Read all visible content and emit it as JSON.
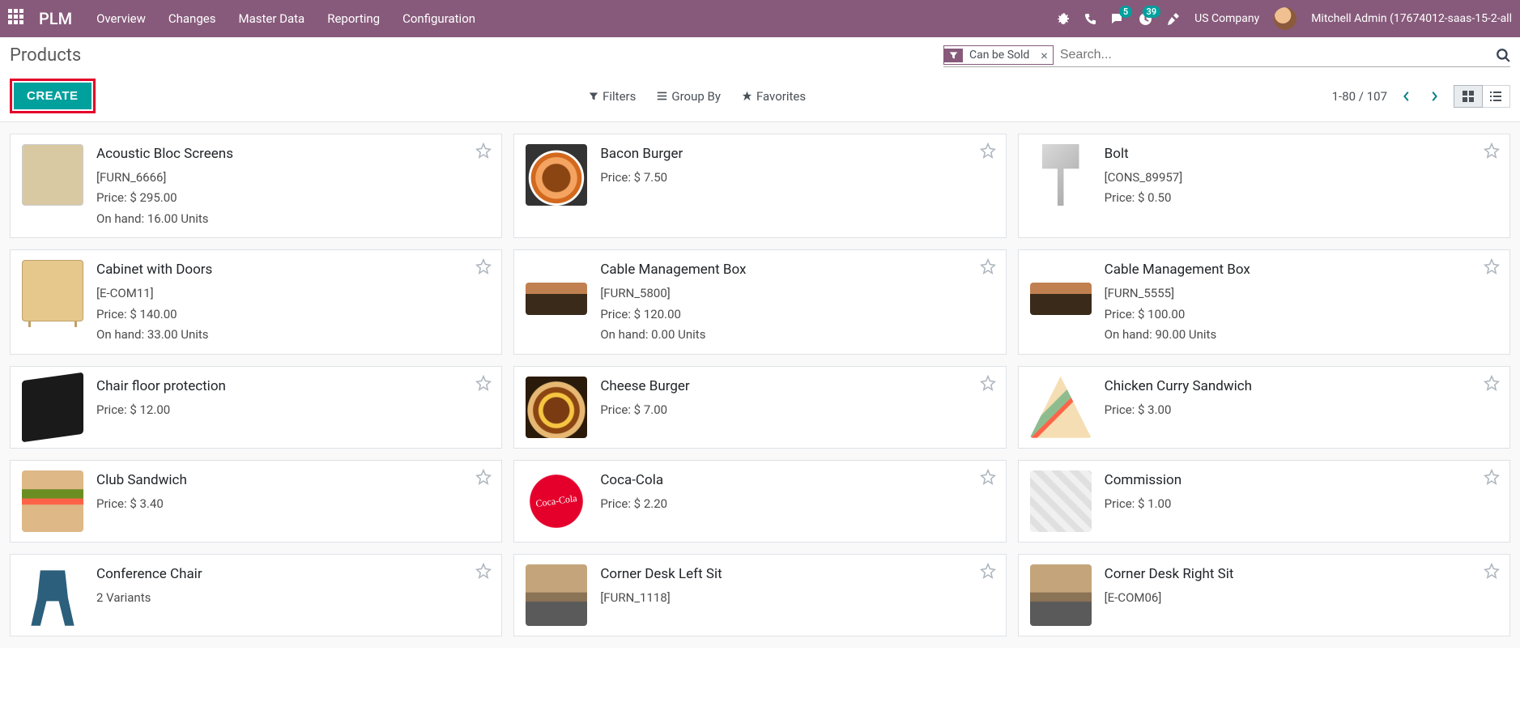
{
  "nav": {
    "brand": "PLM",
    "menu": [
      "Overview",
      "Changes",
      "Master Data",
      "Reporting",
      "Configuration"
    ],
    "messaging_count": "5",
    "activities_count": "39",
    "company": "US Company",
    "user": "Mitchell Admin (17674012-saas-15-2-all"
  },
  "breadcrumb": "Products",
  "search": {
    "facet_label": "Can be Sold",
    "placeholder": "Search..."
  },
  "buttons": {
    "create": "CREATE",
    "filters": "Filters",
    "groupby": "Group By",
    "favorites": "Favorites"
  },
  "pager": {
    "range": "1-80",
    "sep": " / ",
    "total": "107"
  },
  "labels": {
    "price_prefix": "Price: ",
    "onhand_prefix": "On hand: ",
    "variants_suffix": " Variants"
  },
  "products": [
    {
      "name": "Acoustic Bloc Screens",
      "code": "[FURN_6666]",
      "price": "$ 295.00",
      "onhand": "16.00 Units",
      "img": "ph-screen"
    },
    {
      "name": "Bacon Burger",
      "code": "",
      "price": "$ 7.50",
      "onhand": "",
      "img": "ph-burger"
    },
    {
      "name": "Bolt",
      "code": "[CONS_89957]",
      "price": "$ 0.50",
      "onhand": "",
      "img": "ph-bolt"
    },
    {
      "name": "Cabinet with Doors",
      "code": "[E-COM11]",
      "price": "$ 140.00",
      "onhand": "33.00 Units",
      "img": "ph-cabinet"
    },
    {
      "name": "Cable Management Box",
      "code": "[FURN_5800]",
      "price": "$ 120.00",
      "onhand": "0.00 Units",
      "img": "ph-cablebox"
    },
    {
      "name": "Cable Management Box",
      "code": "[FURN_5555]",
      "price": "$ 100.00",
      "onhand": "90.00 Units",
      "img": "ph-cablebox"
    },
    {
      "name": "Chair floor protection",
      "code": "",
      "price": "$ 12.00",
      "onhand": "",
      "img": "ph-mat"
    },
    {
      "name": "Cheese Burger",
      "code": "",
      "price": "$ 7.00",
      "onhand": "",
      "img": "ph-cheeseburger"
    },
    {
      "name": "Chicken Curry Sandwich",
      "code": "",
      "price": "$ 3.00",
      "onhand": "",
      "img": "ph-sandwich"
    },
    {
      "name": "Club Sandwich",
      "code": "",
      "price": "$ 3.40",
      "onhand": "",
      "img": "ph-club"
    },
    {
      "name": "Coca-Cola",
      "code": "",
      "price": "$ 2.20",
      "onhand": "",
      "img": "ph-coke"
    },
    {
      "name": "Commission",
      "code": "",
      "price": "$ 1.00",
      "onhand": "",
      "img": "ph-commission"
    },
    {
      "name": "Conference Chair",
      "code": "",
      "price": "",
      "onhand": "",
      "variants": "2",
      "img": "ph-chair"
    },
    {
      "name": "Corner Desk Left Sit",
      "code": "[FURN_1118]",
      "price": "",
      "onhand": "",
      "img": "ph-desk"
    },
    {
      "name": "Corner Desk Right Sit",
      "code": "[E-COM06]",
      "price": "",
      "onhand": "",
      "img": "ph-desk"
    }
  ]
}
